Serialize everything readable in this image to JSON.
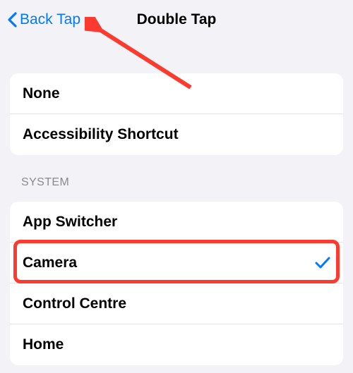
{
  "nav": {
    "back_label": "Back Tap",
    "title": "Double Tap"
  },
  "group1": {
    "items": [
      {
        "label": "None",
        "selected": false
      },
      {
        "label": "Accessibility Shortcut",
        "selected": false
      }
    ]
  },
  "section_system": {
    "header": "System",
    "items": [
      {
        "label": "App Switcher",
        "selected": false
      },
      {
        "label": "Camera",
        "selected": true
      },
      {
        "label": "Control Centre",
        "selected": false
      },
      {
        "label": "Home",
        "selected": false
      }
    ]
  },
  "colors": {
    "accent": "#007aff",
    "annotation": "#fb3b30"
  },
  "annotations": {
    "highlight_row": "Camera",
    "arrow_target": "Back Tap"
  }
}
